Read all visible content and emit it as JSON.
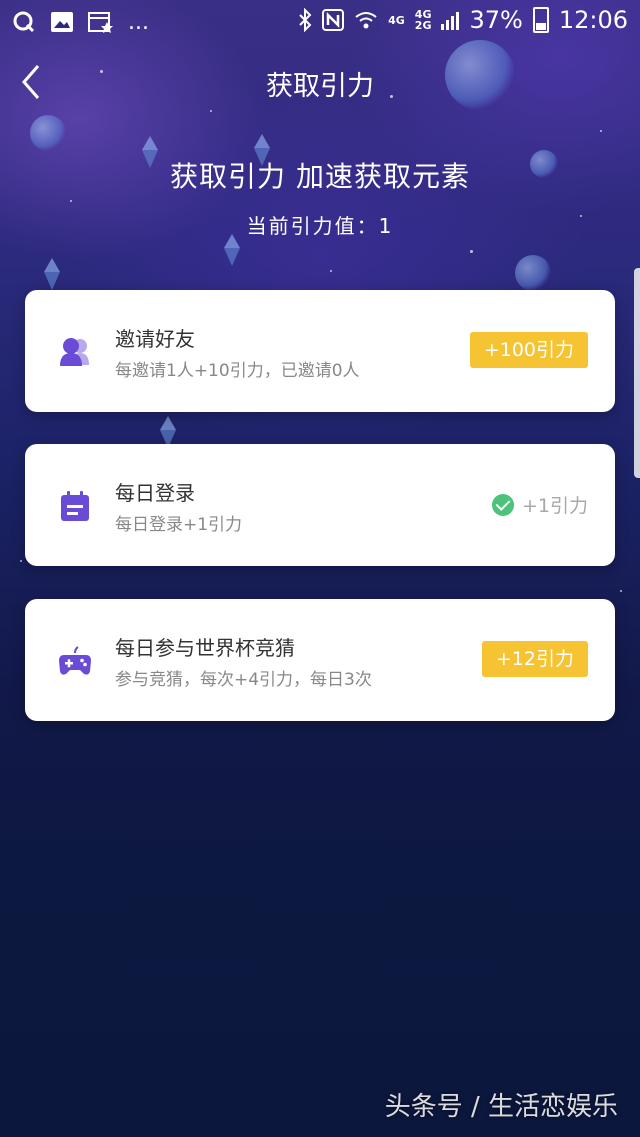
{
  "status_bar": {
    "battery_percent": "37%",
    "time": "12:06",
    "overflow": "...",
    "network_top": "4G",
    "network_stack_top": "4G",
    "network_stack_bottom": "2G"
  },
  "header": {
    "title": "获取引力",
    "back_icon": "chevron-left-icon"
  },
  "hero": {
    "title": "获取引力 加速获取元素",
    "current_value": "当前引力值：1"
  },
  "tasks": [
    {
      "title": "邀请好友",
      "desc": "每邀请1人+10引力，已邀请0人",
      "reward": "+100引力",
      "icon": "friends-icon",
      "completed": false
    },
    {
      "title": "每日登录",
      "desc": "每日登录+1引力",
      "reward": "+1引力",
      "icon": "calendar-icon",
      "completed": true
    },
    {
      "title": "每日参与世界杯竞猜",
      "desc": "参与竞猜，每次+4引力，每日3次",
      "reward": "+12引力",
      "icon": "gamepad-icon",
      "completed": false
    }
  ],
  "colors": {
    "accent_yellow": "#f6c332",
    "icon_purple": "#6a4bd6",
    "check_green": "#4cc27a"
  },
  "watermark": "头条号 / 生活恋娱乐"
}
